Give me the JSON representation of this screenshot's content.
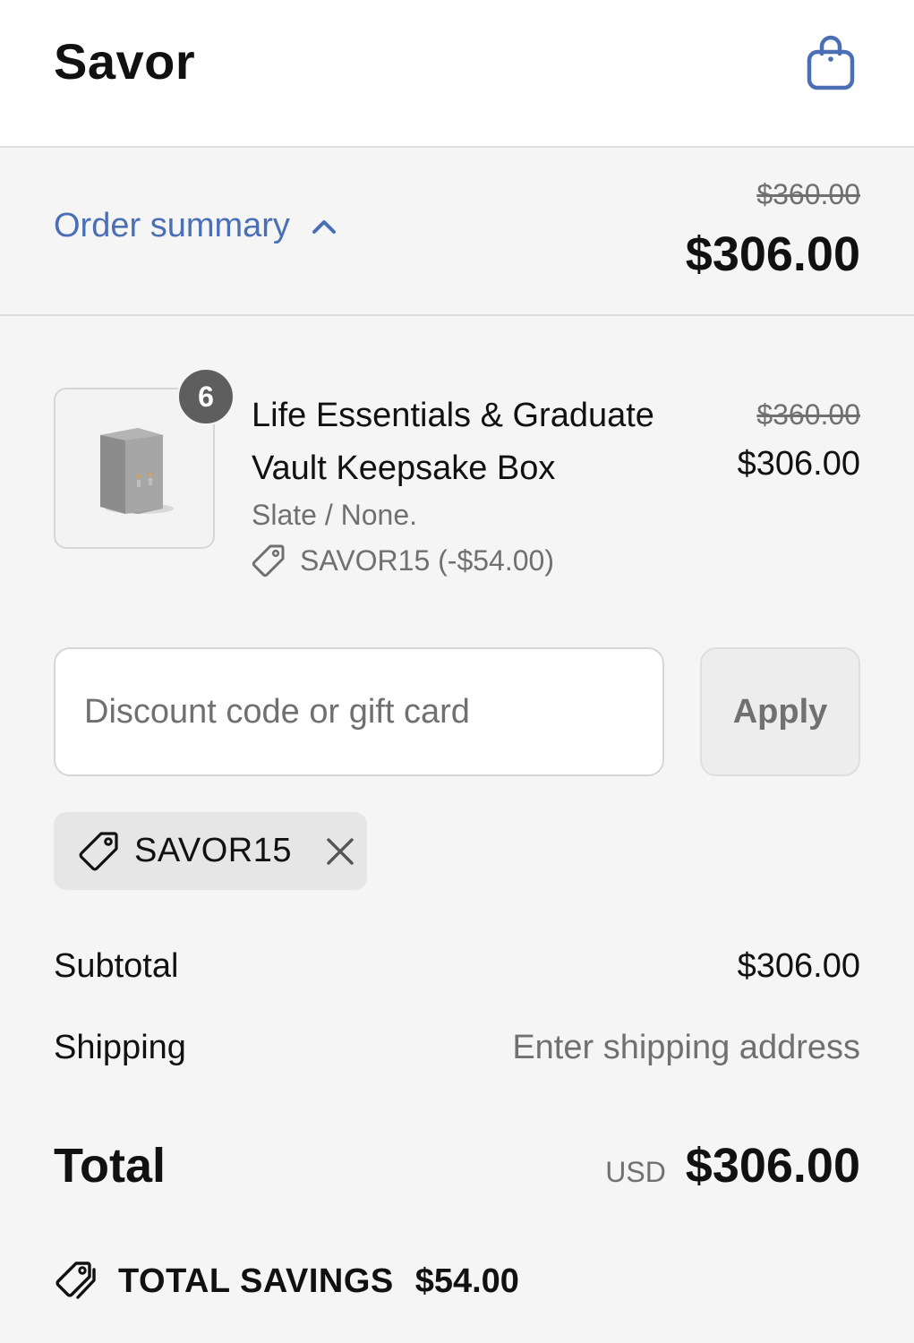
{
  "header": {
    "brand": "Savor",
    "cart_icon": "shopping-bag-icon",
    "accent_color": "#4a6fb5"
  },
  "summary": {
    "toggle_label": "Order summary",
    "toggle_icon": "chevron-up-icon",
    "original_total": "$360.00",
    "total": "$306.00"
  },
  "line_item": {
    "quantity": "6",
    "name": "Life Essentials & Graduate Vault Keepsake Box",
    "variant": "Slate / None.",
    "discount_icon": "tag-icon",
    "discount": "SAVOR15 (-$54.00)",
    "original_price": "$360.00",
    "price": "$306.00"
  },
  "discount_form": {
    "placeholder": "Discount code or gift card",
    "value": "",
    "apply_label": "Apply"
  },
  "applied_code": {
    "icon": "tag-icon",
    "code": "SAVOR15",
    "remove_icon": "close-icon"
  },
  "totals": {
    "subtotal_label": "Subtotal",
    "subtotal_value": "$306.00",
    "shipping_label": "Shipping",
    "shipping_value": "Enter shipping address",
    "total_label": "Total",
    "currency": "USD",
    "total_value": "$306.00"
  },
  "savings": {
    "icon": "tags-icon",
    "label": "TOTAL SAVINGS",
    "value": "$54.00"
  }
}
